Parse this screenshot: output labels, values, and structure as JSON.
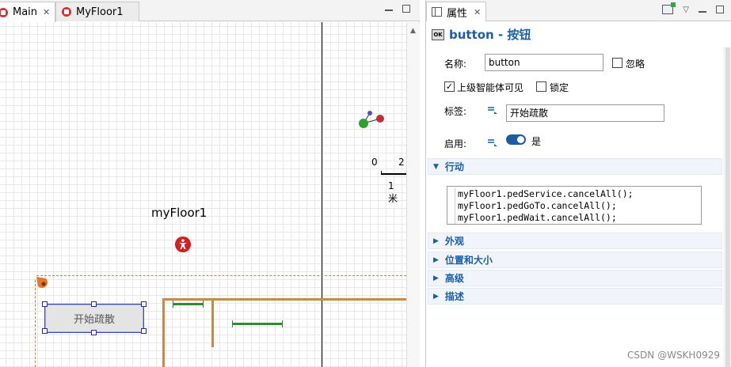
{
  "editor": {
    "tabs": [
      {
        "label": "Main",
        "close": "✕"
      },
      {
        "label": "MyFloor1"
      }
    ],
    "canvas": {
      "floor_label": "myFloor1",
      "scale": {
        "n0": "0",
        "n2": "2",
        "unit": "1米"
      },
      "button_label": "开始疏散"
    }
  },
  "props": {
    "tab_label": "属性",
    "tab_close": "✕",
    "badge": "OK",
    "title": "button - 按钮",
    "name_label": "名称:",
    "name_value": "button",
    "ignore_label": "忽略",
    "parent_visible_label": "上级智能体可见",
    "parent_visible_checked": true,
    "lock_label": "锁定",
    "caption_label": "标签:",
    "caption_value": "开始疏散",
    "enabled_label": "启用:",
    "enabled_value": "是",
    "sections": {
      "action": "行动",
      "appearance": "外观",
      "position": "位置和大小",
      "advanced": "高级",
      "description": "描述"
    },
    "code_lines": [
      "myFloor1.pedService.cancelAll();",
      "myFloor1.pedGoTo.cancelAll();",
      "myFloor1.pedWait.cancelAll();"
    ]
  },
  "watermark": "CSDN @WSKH0929",
  "colors": {
    "accent": "#1a5ea8",
    "wall": "#c98a44",
    "line": "#2e8b2e",
    "ped": "#d22020"
  }
}
